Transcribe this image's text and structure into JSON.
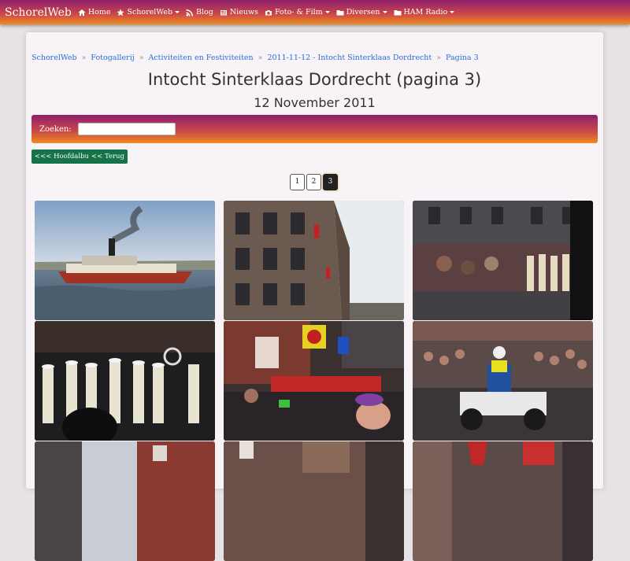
{
  "navbar": {
    "brand": "SchorelWeb",
    "items": [
      {
        "label": "Home",
        "icon": "home-icon"
      },
      {
        "label": "SchorelWeb",
        "icon": "star-icon"
      },
      {
        "label": "Blog",
        "icon": "rss-icon"
      },
      {
        "label": "Nieuws",
        "icon": "newspaper-icon"
      },
      {
        "label": "Foto- & Film",
        "icon": "camera-icon"
      },
      {
        "label": "Diversen",
        "icon": "folder-icon"
      },
      {
        "label": "HAM Radio",
        "icon": "folder-icon"
      }
    ]
  },
  "breadcrumb": [
    "SchorelWeb",
    "Fotogallerij",
    "Activiteiten en Festiviteiten",
    "2011-11-12 - Intocht Sinterklaas Dordrecht",
    "Pagina 3"
  ],
  "page": {
    "title": "Intocht Sinterklaas Dordrecht (pagina 3)",
    "subtitle": "12 November 2011"
  },
  "search": {
    "label": "Zoeken:",
    "value": ""
  },
  "buttons": {
    "main_album": "<<< Hoofdalbum",
    "back": "<< Terug"
  },
  "pagination": {
    "pages": [
      "1",
      "2",
      "3"
    ],
    "current": "3"
  },
  "colors": {
    "accent_start": "#8e1f6d",
    "accent_end": "#f08a1e",
    "button_green": "#157347",
    "link": "#2a6fd6"
  }
}
